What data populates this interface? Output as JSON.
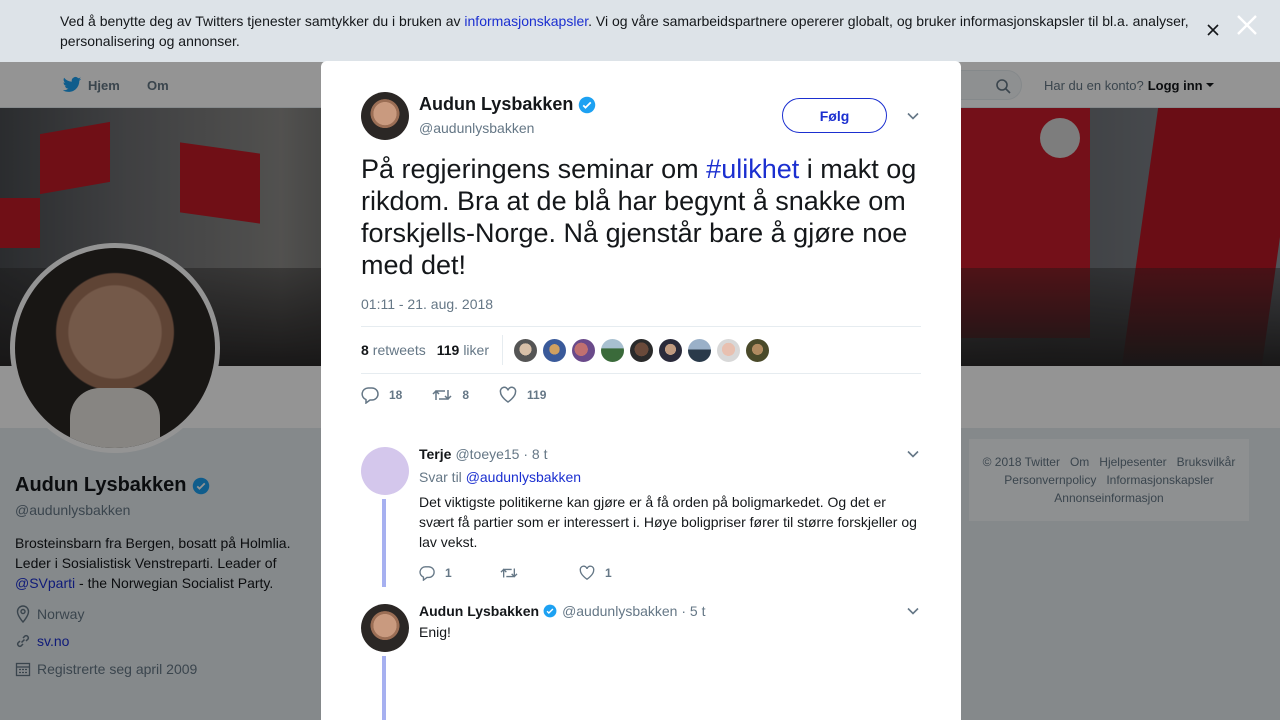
{
  "cookie": {
    "text_before": "Ved å benytte deg av Twitters tjenester samtykker du i bruken av ",
    "link": "informasjonskapsler",
    "text_after": ". Vi og våre samarbeidspartnere opererer globalt, og bruker informasjonskapsler til bl.a. analyser, personalisering og annonser."
  },
  "nav": {
    "home": "Hjem",
    "about": "Om",
    "account_prompt": "Har du en konto?",
    "login": "Logg inn"
  },
  "profile": {
    "name": "Audun Lysbakken",
    "handle": "@audunlysbakken",
    "bio_1": "Brosteinsbarn fra Bergen, bosatt på Holmlia. Leder i Sosialistisk Venstreparti. Leader of ",
    "bio_link": "@SVparti",
    "bio_2": " - the Norwegian Socialist Party.",
    "location": "Norway",
    "website": "sv.no",
    "joined": "Registrerte seg april 2009"
  },
  "footer": {
    "copyright": "© 2018 Twitter",
    "about": "Om",
    "help": "Hjelpesenter",
    "terms": "Bruksvilkår",
    "privacy": "Personvernpolicy",
    "cookies": "Informasjonskapsler",
    "ads": "Annonseinformasjon"
  },
  "tweet": {
    "author_name": "Audun Lysbakken",
    "author_handle": "@audunlysbakken",
    "follow_label": "Følg",
    "text_1": "På regjeringens seminar om ",
    "hashtag": "#ulikhet",
    "text_2": " i makt og rikdom. Bra at de blå har begynt å snakke om forskjells-Norge. Nå gjenstår bare å gjøre noe med det!",
    "timestamp": "01:11 - 21. aug. 2018",
    "retweets_count": "8",
    "retweets_label": "retweets",
    "likes_count": "119",
    "likes_label": "liker",
    "reply_action_count": "18",
    "retweet_action_count": "8",
    "like_action_count": "119"
  },
  "replies": [
    {
      "name": "Terje",
      "handle": "@toeye15",
      "time": "· 8 t",
      "reply_to_label": "Svar til",
      "reply_to_handle": "@audunlysbakken",
      "text": "Det viktigste politikerne kan gjøre er å få orden på boligmarkedet. Og det er svært få partier som er interessert i. Høye boligpriser fører til større forskjeller og lav vekst.",
      "reply_count": "1",
      "like_count": "1"
    },
    {
      "name": "Audun Lysbakken",
      "handle": "@audunlysbakken",
      "time": "· 5 t",
      "text": "Enig!"
    }
  ],
  "colors": {
    "link": "#1b2fd0",
    "verified": "#1da1f2",
    "thread_line": "#a6b0f0"
  }
}
